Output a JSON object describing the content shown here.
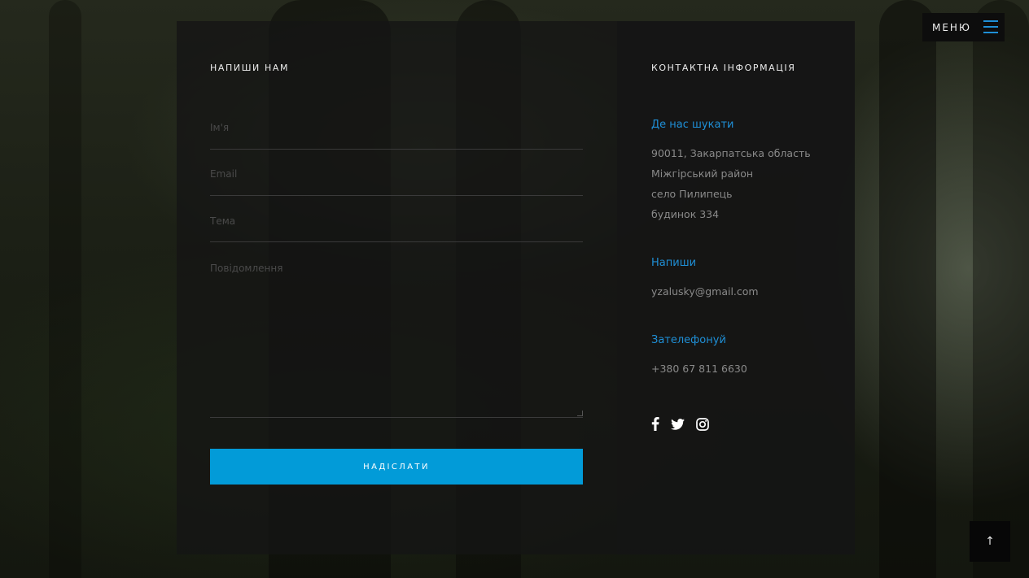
{
  "menu": {
    "label": "МЕНЮ"
  },
  "form": {
    "title": "НАПИШИ НАМ",
    "name_placeholder": "Ім'я",
    "email_placeholder": "Email",
    "subject_placeholder": "Тема",
    "message_placeholder": "Повідомлення",
    "submit_label": "НАДІСЛАТИ"
  },
  "contact": {
    "title": "КОНТАКТНА ІНФОРМАЦІЯ",
    "location_heading": "Де нас шукати",
    "address_lines": [
      "90011, Закарпатська область",
      "Міжгірський район",
      "село Пилипець",
      "будинок 334"
    ],
    "write_heading": "Напиши",
    "email": "yzalusky@gmail.com",
    "call_heading": "Зателефонуй",
    "phone": "+380 67 811 6630"
  },
  "social": {
    "icons": [
      "facebook-icon",
      "twitter-icon",
      "instagram-icon"
    ]
  },
  "scroll_top": {
    "icon": "arrow-up-icon",
    "glyph": "↑"
  },
  "colors": {
    "accent": "#1f8fd6",
    "button": "#029bd8",
    "panel": "#151515"
  }
}
